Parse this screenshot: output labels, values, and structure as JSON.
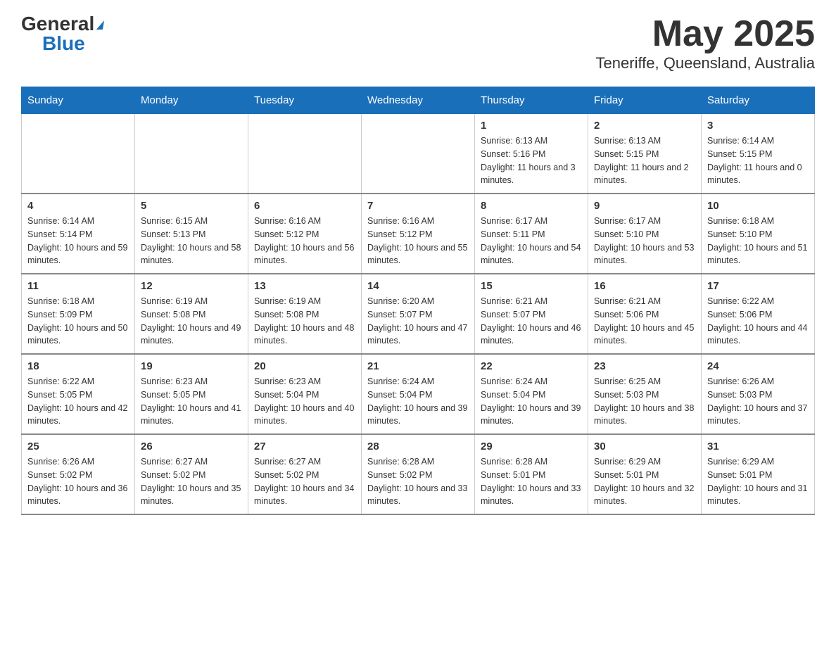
{
  "logo": {
    "general": "General",
    "blue": "Blue"
  },
  "title": "May 2025",
  "subtitle": "Teneriffe, Queensland, Australia",
  "days_of_week": [
    "Sunday",
    "Monday",
    "Tuesday",
    "Wednesday",
    "Thursday",
    "Friday",
    "Saturday"
  ],
  "weeks": [
    [
      {
        "day": "",
        "sunrise": "",
        "sunset": "",
        "daylight": ""
      },
      {
        "day": "",
        "sunrise": "",
        "sunset": "",
        "daylight": ""
      },
      {
        "day": "",
        "sunrise": "",
        "sunset": "",
        "daylight": ""
      },
      {
        "day": "",
        "sunrise": "",
        "sunset": "",
        "daylight": ""
      },
      {
        "day": "1",
        "sunrise": "Sunrise: 6:13 AM",
        "sunset": "Sunset: 5:16 PM",
        "daylight": "Daylight: 11 hours and 3 minutes."
      },
      {
        "day": "2",
        "sunrise": "Sunrise: 6:13 AM",
        "sunset": "Sunset: 5:15 PM",
        "daylight": "Daylight: 11 hours and 2 minutes."
      },
      {
        "day": "3",
        "sunrise": "Sunrise: 6:14 AM",
        "sunset": "Sunset: 5:15 PM",
        "daylight": "Daylight: 11 hours and 0 minutes."
      }
    ],
    [
      {
        "day": "4",
        "sunrise": "Sunrise: 6:14 AM",
        "sunset": "Sunset: 5:14 PM",
        "daylight": "Daylight: 10 hours and 59 minutes."
      },
      {
        "day": "5",
        "sunrise": "Sunrise: 6:15 AM",
        "sunset": "Sunset: 5:13 PM",
        "daylight": "Daylight: 10 hours and 58 minutes."
      },
      {
        "day": "6",
        "sunrise": "Sunrise: 6:16 AM",
        "sunset": "Sunset: 5:12 PM",
        "daylight": "Daylight: 10 hours and 56 minutes."
      },
      {
        "day": "7",
        "sunrise": "Sunrise: 6:16 AM",
        "sunset": "Sunset: 5:12 PM",
        "daylight": "Daylight: 10 hours and 55 minutes."
      },
      {
        "day": "8",
        "sunrise": "Sunrise: 6:17 AM",
        "sunset": "Sunset: 5:11 PM",
        "daylight": "Daylight: 10 hours and 54 minutes."
      },
      {
        "day": "9",
        "sunrise": "Sunrise: 6:17 AM",
        "sunset": "Sunset: 5:10 PM",
        "daylight": "Daylight: 10 hours and 53 minutes."
      },
      {
        "day": "10",
        "sunrise": "Sunrise: 6:18 AM",
        "sunset": "Sunset: 5:10 PM",
        "daylight": "Daylight: 10 hours and 51 minutes."
      }
    ],
    [
      {
        "day": "11",
        "sunrise": "Sunrise: 6:18 AM",
        "sunset": "Sunset: 5:09 PM",
        "daylight": "Daylight: 10 hours and 50 minutes."
      },
      {
        "day": "12",
        "sunrise": "Sunrise: 6:19 AM",
        "sunset": "Sunset: 5:08 PM",
        "daylight": "Daylight: 10 hours and 49 minutes."
      },
      {
        "day": "13",
        "sunrise": "Sunrise: 6:19 AM",
        "sunset": "Sunset: 5:08 PM",
        "daylight": "Daylight: 10 hours and 48 minutes."
      },
      {
        "day": "14",
        "sunrise": "Sunrise: 6:20 AM",
        "sunset": "Sunset: 5:07 PM",
        "daylight": "Daylight: 10 hours and 47 minutes."
      },
      {
        "day": "15",
        "sunrise": "Sunrise: 6:21 AM",
        "sunset": "Sunset: 5:07 PM",
        "daylight": "Daylight: 10 hours and 46 minutes."
      },
      {
        "day": "16",
        "sunrise": "Sunrise: 6:21 AM",
        "sunset": "Sunset: 5:06 PM",
        "daylight": "Daylight: 10 hours and 45 minutes."
      },
      {
        "day": "17",
        "sunrise": "Sunrise: 6:22 AM",
        "sunset": "Sunset: 5:06 PM",
        "daylight": "Daylight: 10 hours and 44 minutes."
      }
    ],
    [
      {
        "day": "18",
        "sunrise": "Sunrise: 6:22 AM",
        "sunset": "Sunset: 5:05 PM",
        "daylight": "Daylight: 10 hours and 42 minutes."
      },
      {
        "day": "19",
        "sunrise": "Sunrise: 6:23 AM",
        "sunset": "Sunset: 5:05 PM",
        "daylight": "Daylight: 10 hours and 41 minutes."
      },
      {
        "day": "20",
        "sunrise": "Sunrise: 6:23 AM",
        "sunset": "Sunset: 5:04 PM",
        "daylight": "Daylight: 10 hours and 40 minutes."
      },
      {
        "day": "21",
        "sunrise": "Sunrise: 6:24 AM",
        "sunset": "Sunset: 5:04 PM",
        "daylight": "Daylight: 10 hours and 39 minutes."
      },
      {
        "day": "22",
        "sunrise": "Sunrise: 6:24 AM",
        "sunset": "Sunset: 5:04 PM",
        "daylight": "Daylight: 10 hours and 39 minutes."
      },
      {
        "day": "23",
        "sunrise": "Sunrise: 6:25 AM",
        "sunset": "Sunset: 5:03 PM",
        "daylight": "Daylight: 10 hours and 38 minutes."
      },
      {
        "day": "24",
        "sunrise": "Sunrise: 6:26 AM",
        "sunset": "Sunset: 5:03 PM",
        "daylight": "Daylight: 10 hours and 37 minutes."
      }
    ],
    [
      {
        "day": "25",
        "sunrise": "Sunrise: 6:26 AM",
        "sunset": "Sunset: 5:02 PM",
        "daylight": "Daylight: 10 hours and 36 minutes."
      },
      {
        "day": "26",
        "sunrise": "Sunrise: 6:27 AM",
        "sunset": "Sunset: 5:02 PM",
        "daylight": "Daylight: 10 hours and 35 minutes."
      },
      {
        "day": "27",
        "sunrise": "Sunrise: 6:27 AM",
        "sunset": "Sunset: 5:02 PM",
        "daylight": "Daylight: 10 hours and 34 minutes."
      },
      {
        "day": "28",
        "sunrise": "Sunrise: 6:28 AM",
        "sunset": "Sunset: 5:02 PM",
        "daylight": "Daylight: 10 hours and 33 minutes."
      },
      {
        "day": "29",
        "sunrise": "Sunrise: 6:28 AM",
        "sunset": "Sunset: 5:01 PM",
        "daylight": "Daylight: 10 hours and 33 minutes."
      },
      {
        "day": "30",
        "sunrise": "Sunrise: 6:29 AM",
        "sunset": "Sunset: 5:01 PM",
        "daylight": "Daylight: 10 hours and 32 minutes."
      },
      {
        "day": "31",
        "sunrise": "Sunrise: 6:29 AM",
        "sunset": "Sunset: 5:01 PM",
        "daylight": "Daylight: 10 hours and 31 minutes."
      }
    ]
  ]
}
